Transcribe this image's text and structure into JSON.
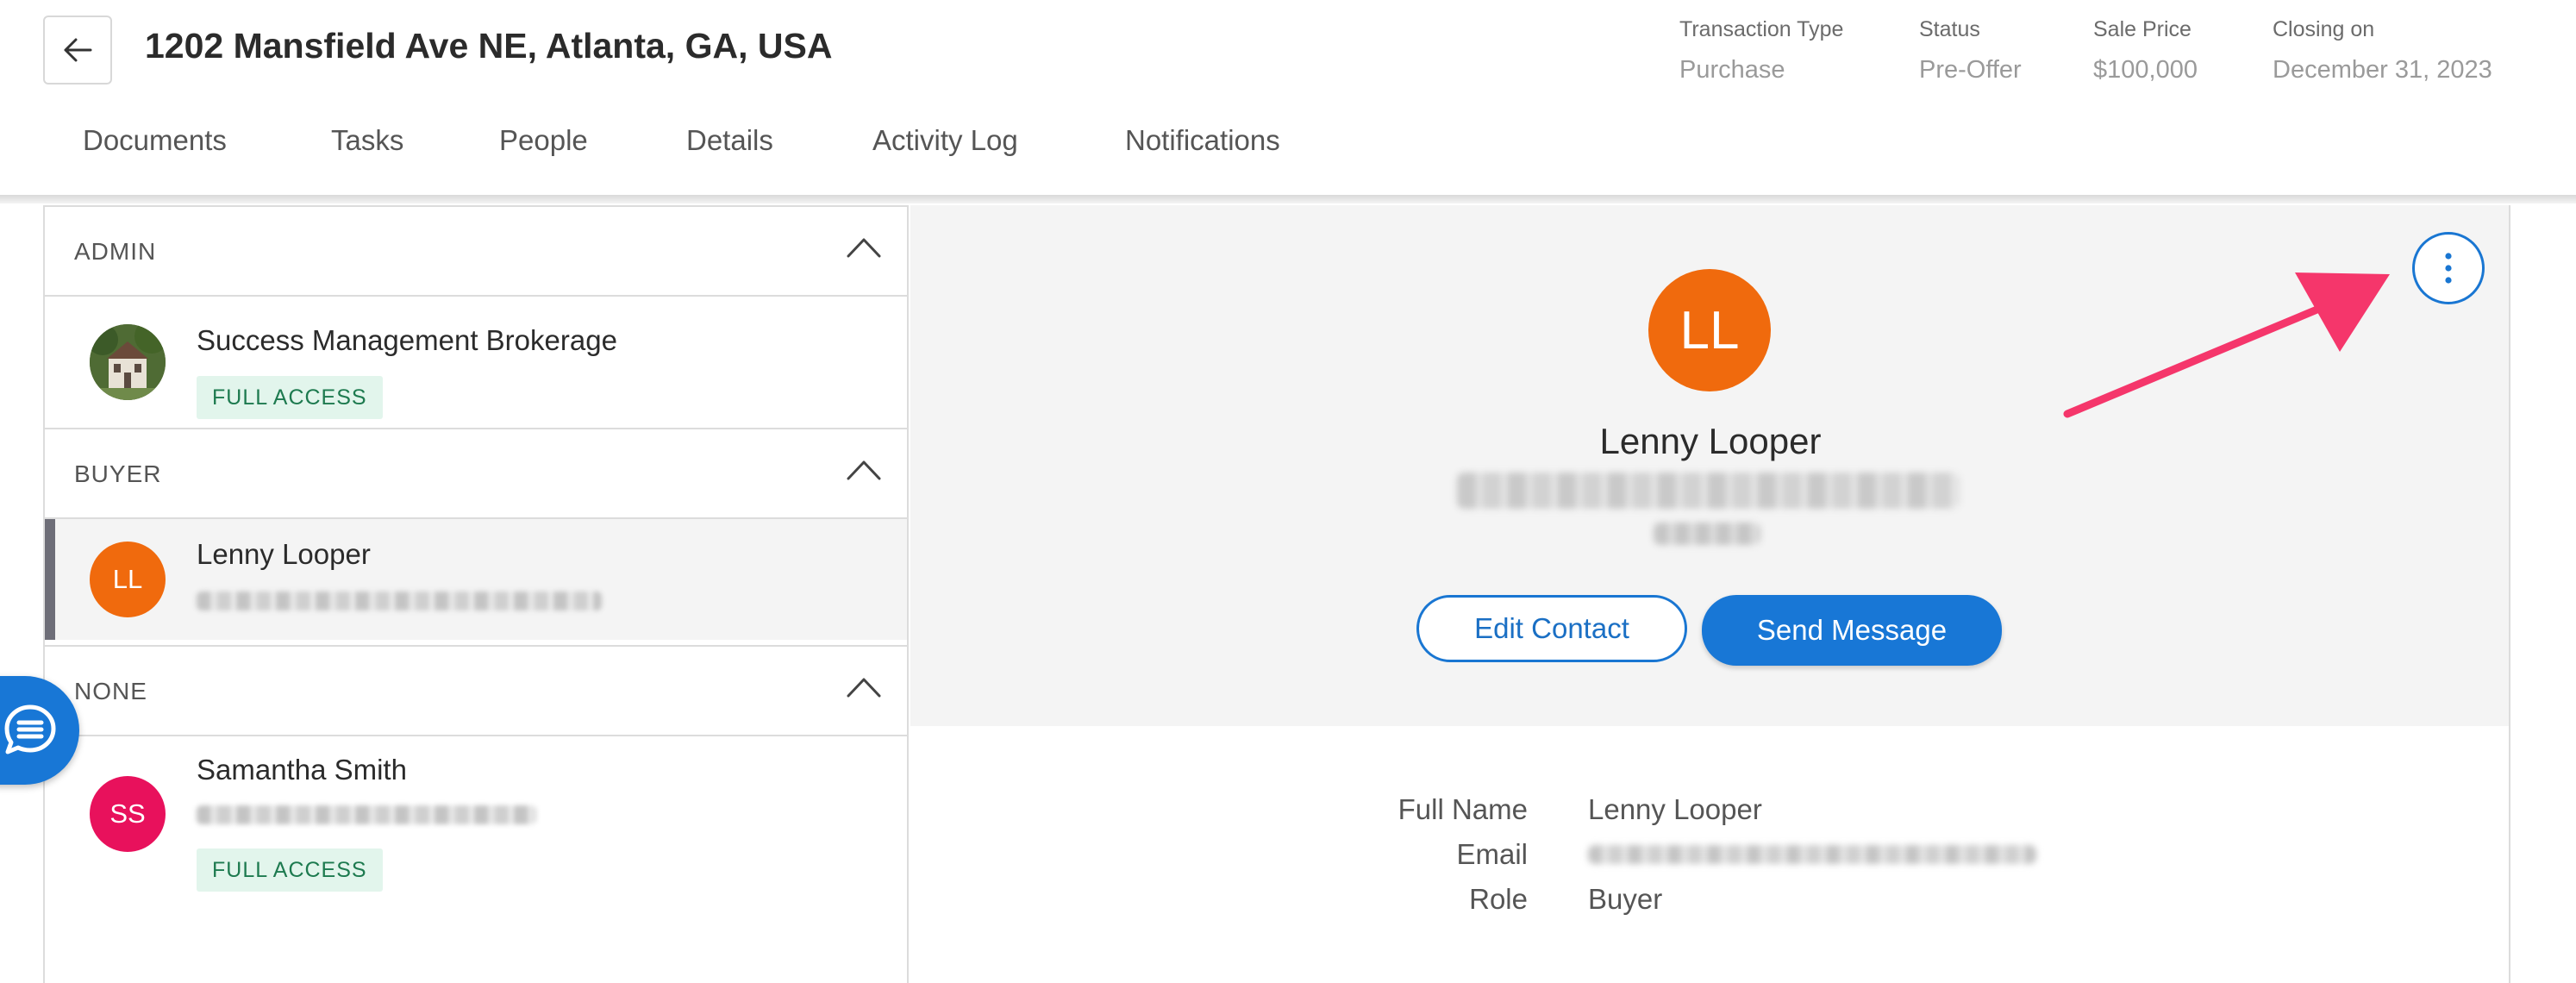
{
  "header": {
    "title": "1202 Mansfield Ave NE, Atlanta, GA, USA",
    "meta": [
      {
        "label": "Transaction Type",
        "value": "Purchase"
      },
      {
        "label": "Status",
        "value": "Pre-Offer"
      },
      {
        "label": "Sale Price",
        "value": "$100,000"
      },
      {
        "label": "Closing on",
        "value": "December 31, 2023"
      }
    ]
  },
  "tabs": [
    "Documents",
    "Tasks",
    "People",
    "Details",
    "Activity Log",
    "Notifications"
  ],
  "people": {
    "sections": [
      {
        "label": "ADMIN"
      },
      {
        "label": "BUYER"
      },
      {
        "label": "NONE"
      }
    ],
    "admin_person": {
      "name": "Success Management Brokerage",
      "badge": "FULL ACCESS"
    },
    "buyer_person": {
      "initials": "LL",
      "name": "Lenny Looper"
    },
    "none_person": {
      "initials": "SS",
      "name": "Samantha Smith",
      "badge": "FULL ACCESS"
    }
  },
  "detail": {
    "initials": "LL",
    "name": "Lenny Looper",
    "edit_label": "Edit Contact",
    "send_label": "Send Message",
    "fields": [
      {
        "label": "Full Name",
        "value": "Lenny Looper"
      },
      {
        "label": "Email",
        "value": ""
      },
      {
        "label": "Role",
        "value": "Buyer"
      }
    ]
  },
  "icons": {
    "back": "arrow-left-icon",
    "chevron": "chevron-up-icon",
    "kebab": "more-vertical-icon",
    "chat": "chat-bubble-icon"
  },
  "colors": {
    "accent": "#1877d6",
    "buyer_avatar": "#f06a0d",
    "none_avatar": "#e8115c",
    "badge_bg": "#e2f5ec",
    "badge_text": "#1d7a4f",
    "annotation_arrow": "#f5366b"
  }
}
